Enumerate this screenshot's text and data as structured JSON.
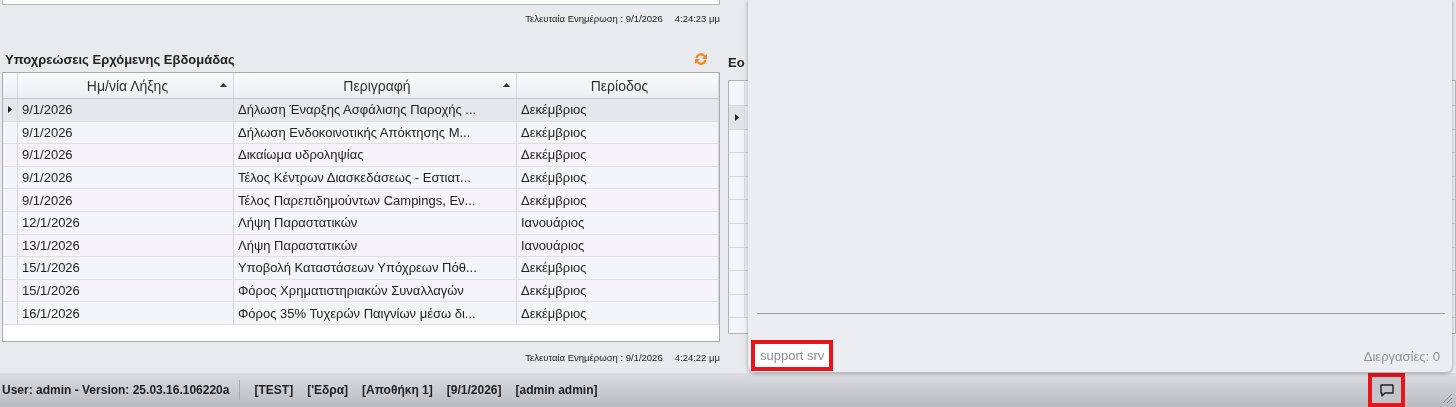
{
  "top_panel": {
    "last_update": "Τελευταία Ενημέρωση : 9/1/2026",
    "time": "4:24:23 μμ"
  },
  "obligations": {
    "title": "Υποχρεώσεις Ερχόμενης Εβδομάδας",
    "columns": [
      {
        "label": "Ημ/νία Λήξης",
        "sort_indicator": true
      },
      {
        "label": "Περιγραφή",
        "sort_indicator": true
      },
      {
        "label": "Περίοδος",
        "sort_indicator": false
      }
    ],
    "rows": [
      {
        "date": "9/1/2026",
        "description": "Δήλωση Έναρξης Ασφάλισης Παροχής ...",
        "period": "Δεκέμβριος",
        "selected": true
      },
      {
        "date": "9/1/2026",
        "description": "Δήλωση Ενδοκοινοτικής Απόκτησης Μ...",
        "period": "Δεκέμβριος",
        "selected": false
      },
      {
        "date": "9/1/2026",
        "description": "Δικαίωμα υδροληψίας",
        "period": "Δεκέμβριος",
        "selected": false
      },
      {
        "date": "9/1/2026",
        "description": "Τέλος Κέντρων Διασκεδάσεως - Εστιατ...",
        "period": "Δεκέμβριος",
        "selected": false
      },
      {
        "date": "9/1/2026",
        "description": "Τέλος Παρεπιδημούντων Campings, Εν...",
        "period": "Δεκέμβριος",
        "selected": false
      },
      {
        "date": "12/1/2026",
        "description": "Λήψη Παραστατικών",
        "period": "Ιανουάριος",
        "selected": false
      },
      {
        "date": "13/1/2026",
        "description": "Λήψη Παραστατικών",
        "period": "Ιανουάριος",
        "selected": false
      },
      {
        "date": "15/1/2026",
        "description": "Υποβολή Καταστάσεων Υπόχρεων Πόθ...",
        "period": "Δεκέμβριος",
        "selected": false
      },
      {
        "date": "15/1/2026",
        "description": "Φόρος Χρηματιστηριακών Συναλλαγών",
        "period": "Δεκέμβριος",
        "selected": false
      },
      {
        "date": "16/1/2026",
        "description": "Φόρος 35% Τυχερών Παιγνίων μέσω δι...",
        "period": "Δεκέμβριος",
        "selected": false
      }
    ],
    "last_update": "Τελευταία Ενημέρωση : 9/1/2026",
    "time": "4:24:22 μμ"
  },
  "side_panel": {
    "title": "Εο",
    "rows": [
      {
        "selected": true
      },
      {
        "selected": false
      },
      {
        "selected": false
      },
      {
        "selected": false
      },
      {
        "selected": false
      },
      {
        "selected": false
      },
      {
        "selected": false
      },
      {
        "selected": false
      },
      {
        "selected": false
      }
    ]
  },
  "overlay": {
    "server": "support srv",
    "server_highlighted": true,
    "processes": "Διεργασίες: 0"
  },
  "status_bar": {
    "user": "User: admin - Version: 25.03.16.106220a",
    "items": [
      "[TEST]",
      "['Εδρα]",
      "[Αποθήκη 1]",
      "[9/1/2026]",
      "[admin admin]"
    ],
    "chat_highlighted": true
  }
}
